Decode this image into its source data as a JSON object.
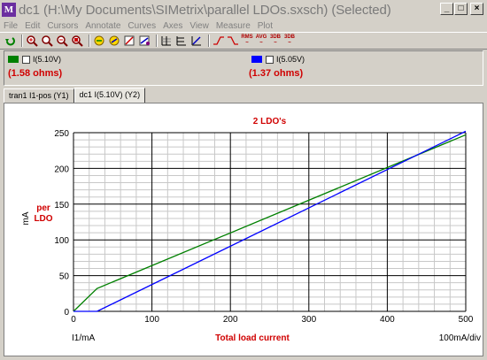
{
  "window": {
    "title": "dc1 (H:\\My Documents\\SIMetrix\\parallel LDOs.sxsch) (Selected)",
    "app_icon_text": "M",
    "minimize": "_",
    "maximize": "□",
    "close": "×"
  },
  "menu": [
    "File",
    "Edit",
    "Cursors",
    "Annotate",
    "Curves",
    "Axes",
    "View",
    "Measure",
    "Plot"
  ],
  "toolbar": {
    "labels": [
      "RMS",
      "AVG",
      "3DB",
      "3DB"
    ]
  },
  "legend": {
    "items": [
      {
        "label": "I(5.10V)",
        "value": "(1.58 ohms)",
        "color": "#008000"
      },
      {
        "label": "I(5.05V)",
        "value": "(1.37 ohms)",
        "color": "#0000ff"
      }
    ]
  },
  "tabs": [
    {
      "label": "tran1 I1-pos (Y1)"
    },
    {
      "label": "dc1 I(5.10V) (Y2)"
    }
  ],
  "chart_data": {
    "type": "line",
    "title": "2 LDO's",
    "xlabel": "Total load current",
    "x_axis_name": "I1/mA",
    "x_scale": "100mA/div",
    "ylabel_unit": "mA",
    "ylabel": "per LDO",
    "xlim": [
      0,
      500
    ],
    "ylim": [
      0,
      250
    ],
    "x_ticks": [
      "0",
      "100",
      "200",
      "300",
      "400",
      "500"
    ],
    "y_ticks": [
      "0",
      "50",
      "100",
      "150",
      "200",
      "250"
    ],
    "grid": true,
    "series": [
      {
        "name": "I(5.10V)",
        "color": "#008000",
        "x": [
          0,
          30,
          500
        ],
        "y": [
          0,
          32,
          247
        ]
      },
      {
        "name": "I(5.05V)",
        "color": "#0000ff",
        "x": [
          0,
          30,
          500
        ],
        "y": [
          0,
          0,
          252
        ]
      }
    ],
    "title_color": "#d00000",
    "annotation_color": "#d00000"
  }
}
